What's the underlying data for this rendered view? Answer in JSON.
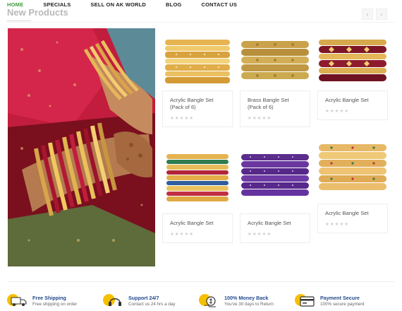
{
  "nav": {
    "items": [
      "HOME",
      "SPECIALS",
      "SELL ON AK WORLD",
      "BLOG",
      "CONTACT US"
    ],
    "active_index": 0
  },
  "section": {
    "title": "New Products",
    "prev_arrow": "‹",
    "next_arrow": "›"
  },
  "products": [
    {
      "name": "Acrylic Bangle Set (Pack of 6)",
      "rating": "★★★★★",
      "variant": "gold-red"
    },
    {
      "name": "Brass Bangle Set (Pack of 6)",
      "rating": "★★★★★",
      "variant": "brass"
    },
    {
      "name": "Acrylic Bangle Set",
      "rating": "★★★★★",
      "variant": "gold-maroon"
    },
    {
      "name": "Acrylic Bangle Set",
      "rating": "★★★★★",
      "variant": "gold-multi"
    },
    {
      "name": "Acrylic Bangle Set",
      "rating": "★★★★★",
      "variant": "purple"
    },
    {
      "name": "Acrylic Bangle Set",
      "rating": "★★★★★",
      "variant": "gold-beaded"
    }
  ],
  "features": [
    {
      "title": "Free Shipping",
      "subtitle": "Free shipping on order",
      "icon": "truck-icon"
    },
    {
      "title": "Support 24/7",
      "subtitle": "Contact us 24 hrs a day",
      "icon": "headset-icon"
    },
    {
      "title": "100% Money Back",
      "subtitle": "You've 30 days to Return",
      "icon": "money-back-icon"
    },
    {
      "title": "Payment Secure",
      "subtitle": "100% secure payment",
      "icon": "credit-card-icon"
    }
  ],
  "colors": {
    "accent": "#3f9a3a",
    "feature_title": "#234a8f",
    "feature_icon_bg": "#f5c000"
  }
}
